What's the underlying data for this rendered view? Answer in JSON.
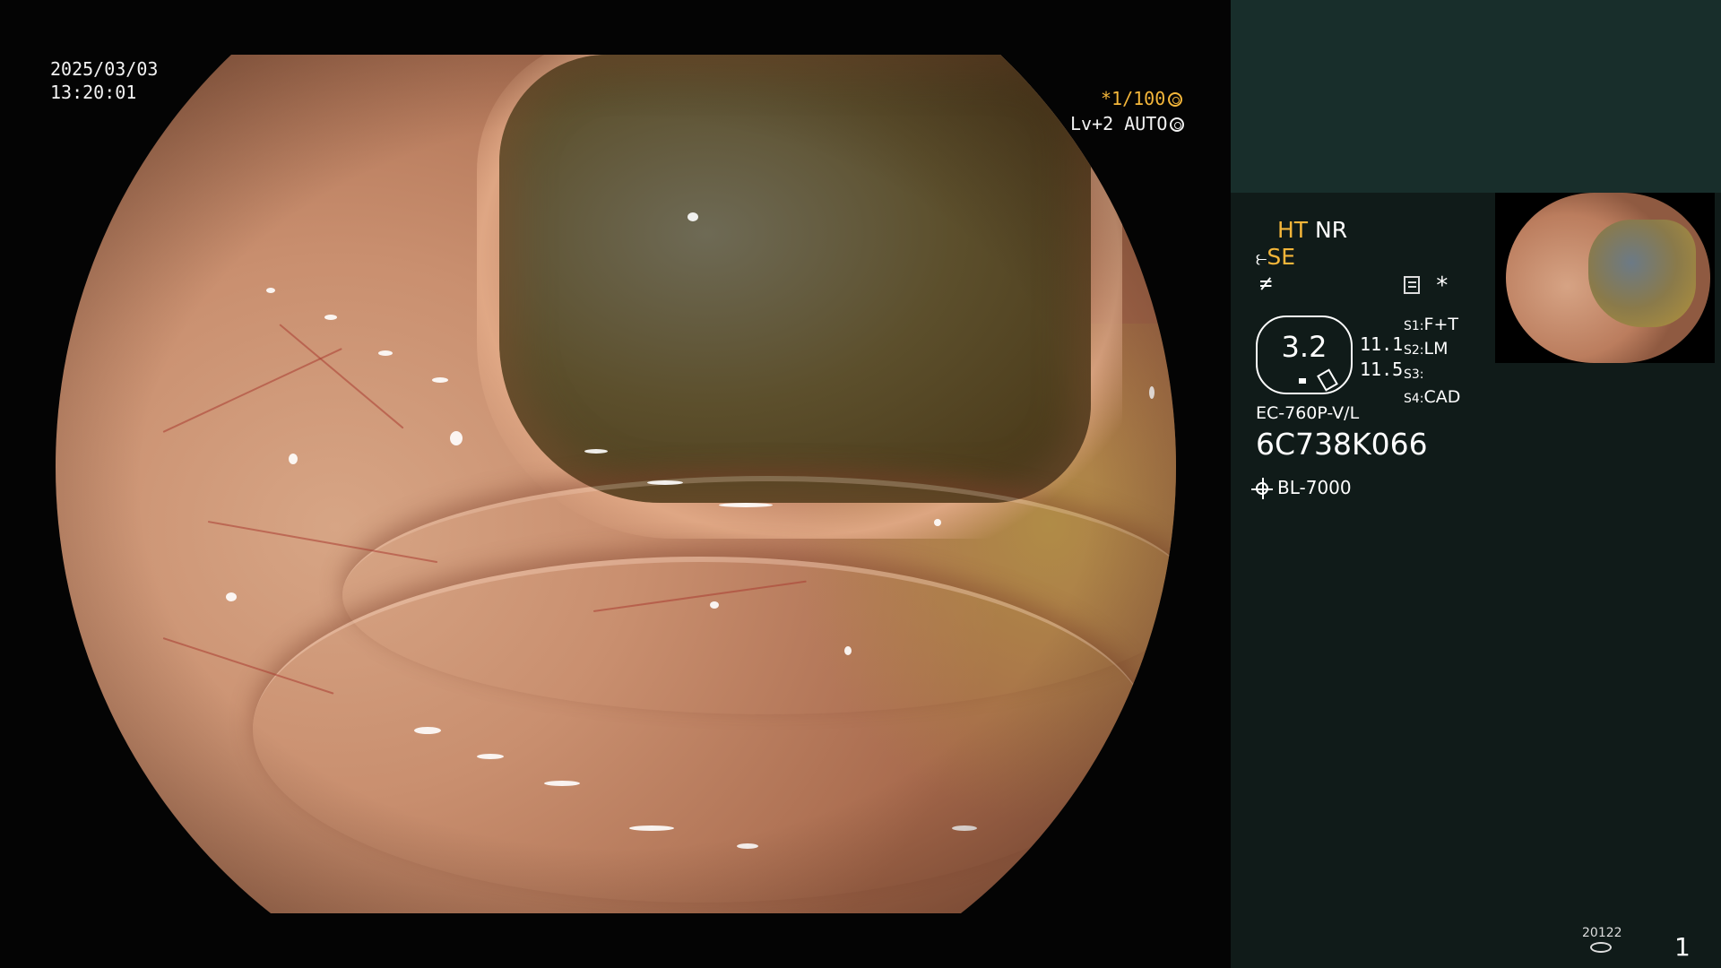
{
  "overlay": {
    "date": "2025/03/03",
    "time": "13:20:01",
    "shutter": "*1/100",
    "level": "Lv+2",
    "mode": "AUTO"
  },
  "panel": {
    "ht": "HT",
    "nr": "NR",
    "se": "SE",
    "scope_value": "3.2",
    "scope_n1": "11.1",
    "scope_n2": "11.5",
    "switches": [
      {
        "key": "S1:",
        "value": "F+T"
      },
      {
        "key": "S2:",
        "value": "LM"
      },
      {
        "key": "S3:",
        "value": ""
      },
      {
        "key": "S4:",
        "value": "CAD"
      }
    ],
    "model": "EC-760P-V/L",
    "serial": "6C738K066",
    "light_source": "BL-7000",
    "counter": "20122",
    "page_number": "1"
  },
  "colors": {
    "accent": "#f4b63a",
    "panel_bg": "#101b19",
    "panel_top": "#182e2b"
  }
}
